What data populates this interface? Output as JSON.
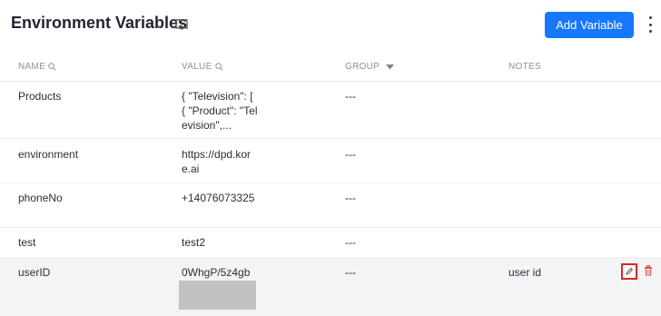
{
  "header": {
    "title": "Environment Variables",
    "add_button_label": "Add Variable"
  },
  "columns": {
    "name": "NAME",
    "value": "VALUE",
    "group": "GROUP",
    "notes": "NOTES"
  },
  "rows": [
    {
      "name": "Products",
      "value": "{ \"Television\": [ { \"Product\": \"Television\",...",
      "group": "---",
      "notes": ""
    },
    {
      "name": "environment",
      "value": "https://dpd.kore.ai",
      "group": "---",
      "notes": ""
    },
    {
      "name": "phoneNo",
      "value": "+14076073325",
      "group": "---",
      "notes": ""
    },
    {
      "name": "test",
      "value": "test2",
      "group": "---",
      "notes": ""
    },
    {
      "name": "userID",
      "value": "0WhgP/5z4gb",
      "group": "---",
      "notes": "user id"
    }
  ],
  "colors": {
    "primary": "#1677ff",
    "selected_row": "#f3f4f6",
    "highlight": "#e02424"
  },
  "icons": {
    "title_icon": "book-icon",
    "menu": "kebab-menu-icon",
    "search": "search-icon",
    "sort": "sort-down-icon",
    "edit": "pencil-icon",
    "delete": "trash-icon"
  }
}
